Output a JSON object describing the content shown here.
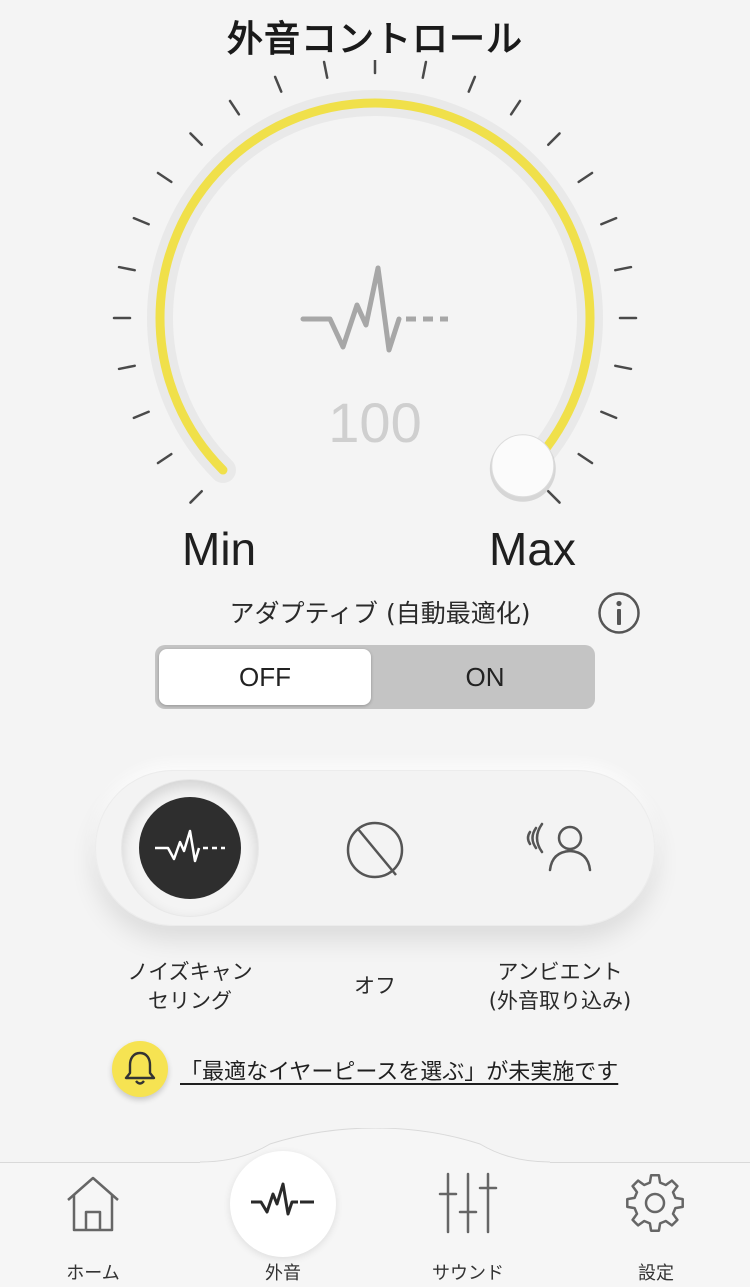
{
  "header": {
    "title": "外音コントロール"
  },
  "dial": {
    "value": "100",
    "level_fraction": 1.0,
    "min_label": "Min",
    "max_label": "Max",
    "accent_color": "#f0e04a",
    "center_icon": "waveform-icon"
  },
  "adaptive": {
    "label": "アダプティブ (自動最適化)",
    "info_icon": "info-icon",
    "options": [
      "OFF",
      "ON"
    ],
    "selected": "OFF"
  },
  "modes": [
    {
      "id": "noise-cancelling",
      "label_line1": "ノイズキャン",
      "label_line2": "セリング",
      "icon": "noise-cancel-icon",
      "selected": true
    },
    {
      "id": "off",
      "label_line1": "オフ",
      "label_line2": "",
      "icon": "off-icon",
      "selected": false
    },
    {
      "id": "ambient",
      "label_line1": "アンビエント",
      "label_line2": "(外音取り込み)",
      "icon": "ambient-icon",
      "selected": false
    }
  ],
  "notice": {
    "text": "「最適なイヤーピースを選ぶ」が未実施です",
    "icon": "bell-icon",
    "color": "#f6e352"
  },
  "tabs": [
    {
      "label": "ホーム",
      "icon": "home-icon"
    },
    {
      "label": "外音",
      "icon": "waveform-icon",
      "active": true
    },
    {
      "label": "サウンド",
      "icon": "equalizer-icon"
    },
    {
      "label": "設定",
      "icon": "gear-icon"
    }
  ]
}
